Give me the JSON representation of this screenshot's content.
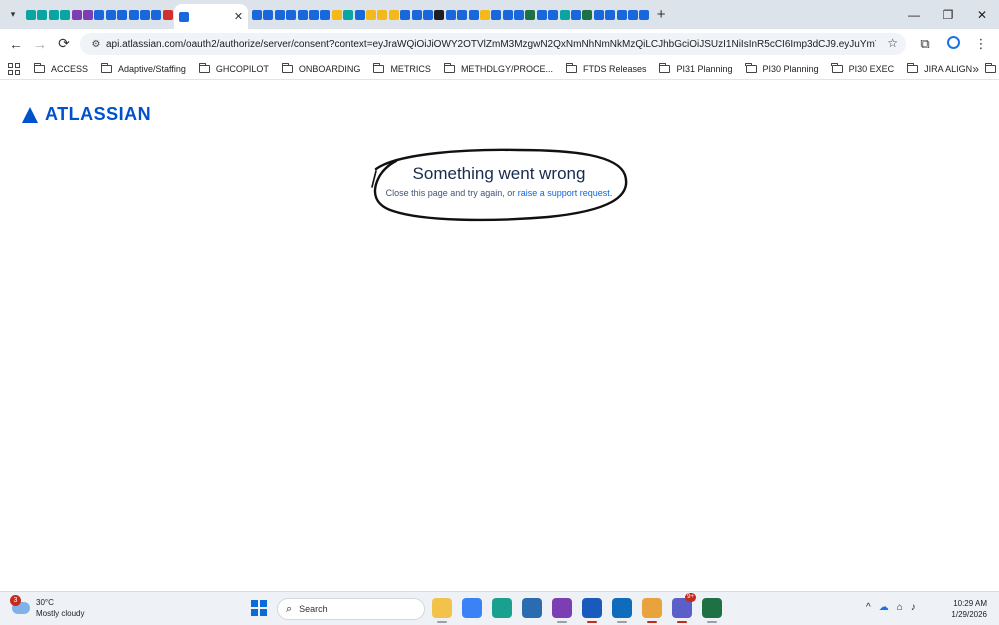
{
  "browser": {
    "url": "api.atlassian.com/oauth2/authorize/server/consent?context=eyJraWQiOiJiOWY2OTVlZmM3MzgwN2QxNmNhNmNkMzQiLCJhbGciOiJSUzI1NiIsInR5cCI6Imp3dCJ9.eyJuYmYiOjE3Njk2...",
    "new_tab_label": "+",
    "tab_close_label": "✕",
    "window": {
      "minimize": "—",
      "maximize": "❐",
      "close": "✕"
    },
    "nav": {
      "back": "←",
      "forward": "→",
      "reload": "⟳",
      "site_info": "⚙",
      "star": "☆",
      "extensions": "⧉"
    }
  },
  "tabs": {
    "icon_colors": [
      "#0aa5a3",
      "#0aa5a3",
      "#0aa5a3",
      "#0aa5a3",
      "#7b3fb3",
      "#7b3fb3",
      "#1868db",
      "#1868db",
      "#1868db",
      "#1868db",
      "#1868db",
      "#1868db",
      "#d0302f",
      "#1868db",
      "#1868db",
      "#1868db",
      "#1868db",
      "#1868db",
      "#1868db",
      "#1868db",
      "#f5b81a",
      "#0aa5a3",
      "#1868db",
      "#f5b81a",
      "#f5b81a",
      "#f5b81a",
      "#1868db",
      "#1868db",
      "#1868db",
      "#1f1f1f",
      "#1868db",
      "#1868db",
      "#1868db",
      "#f5b81a",
      "#1868db",
      "#1868db",
      "#1868db",
      "#1e7145",
      "#1868db",
      "#1868db",
      "#0aa5a3",
      "#1868db",
      "#1e7145",
      "#1868db",
      "#1868db",
      "#1868db",
      "#1868db",
      "#1868db"
    ],
    "active_icon_color": "#1868db"
  },
  "bookmarks": {
    "overflow": "»",
    "items": [
      "ACCESS",
      "Adaptive/Staffing",
      "GHCOPILOT",
      "ONBOARDING",
      "METRICS",
      "METHDLGY/PROCE...",
      "FTDS Releases",
      "PI31 Planning",
      "PI30 Planning",
      "PI30 EXEC",
      "JIRA ALIGN",
      "JIRA"
    ]
  },
  "page": {
    "logo_text": "ATLASSIAN",
    "logo_color": "#0052cc",
    "error_title": "Something went wrong",
    "error_message": "Close this page and try again, or ",
    "support_link": "raise a support request",
    "error_message_end": "."
  },
  "taskbar": {
    "weather_temp": "30°C",
    "weather_desc": "Mostly cloudy",
    "weather_badge": "3",
    "search_label": "Search",
    "search_icon": "⌕",
    "teams_badge": "9+",
    "tray_chevron": "^",
    "tray_icons": [
      "⌂",
      "♪"
    ],
    "time": "10:29 AM",
    "date": "1/29/2026",
    "apps": [
      {
        "name": "file-explorer",
        "color": "#f2c24a"
      },
      {
        "name": "copilot",
        "color": "#3b82f6"
      },
      {
        "name": "edge",
        "color": "#1aa08f"
      },
      {
        "name": "store",
        "color": "#2b6cb0"
      },
      {
        "name": "onenote",
        "color": "#7b3fb3"
      },
      {
        "name": "word",
        "color": "#185abd"
      },
      {
        "name": "outlook",
        "color": "#0f6cbd"
      },
      {
        "name": "chrome",
        "color": "#e8a33d"
      },
      {
        "name": "teams",
        "color": "#5b5fc7"
      },
      {
        "name": "excel",
        "color": "#1e7145"
      }
    ]
  }
}
